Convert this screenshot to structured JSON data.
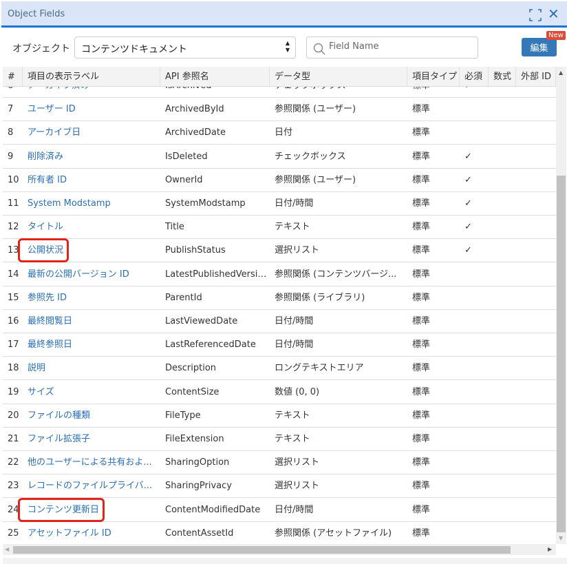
{
  "window": {
    "title": "Object Fields"
  },
  "toolbar": {
    "object_label": "オブジェクト",
    "object_value": "コンテンツドキュメント",
    "search_placeholder": "Field Name",
    "edit_label": "編集",
    "new_badge": "New"
  },
  "columns": [
    "#",
    "項目の表示ラベル",
    "API 参照名",
    "データ型",
    "項目タイプ",
    "必須",
    "数式",
    "外部 ID"
  ],
  "rows": [
    {
      "n": "6",
      "label": "アーカイブ済み",
      "api": "IsArchived",
      "type": "チェックボックス",
      "kind": "標準",
      "req": "✓"
    },
    {
      "n": "7",
      "label": "ユーザー ID",
      "api": "ArchivedById",
      "type": "参照関係 (ユーザー)",
      "kind": "標準",
      "req": ""
    },
    {
      "n": "8",
      "label": "アーカイブ日",
      "api": "ArchivedDate",
      "type": "日付",
      "kind": "標準",
      "req": ""
    },
    {
      "n": "9",
      "label": "削除済み",
      "api": "IsDeleted",
      "type": "チェックボックス",
      "kind": "標準",
      "req": "✓"
    },
    {
      "n": "10",
      "label": "所有者 ID",
      "api": "OwnerId",
      "type": "参照関係 (ユーザー)",
      "kind": "標準",
      "req": "✓"
    },
    {
      "n": "11",
      "label": "System Modstamp",
      "api": "SystemModstamp",
      "type": "日付/時間",
      "kind": "標準",
      "req": "✓"
    },
    {
      "n": "12",
      "label": "タイトル",
      "api": "Title",
      "type": "テキスト",
      "kind": "標準",
      "req": "✓"
    },
    {
      "n": "13",
      "label": "公開状況",
      "api": "PublishStatus",
      "type": "選択リスト",
      "kind": "標準",
      "req": "✓",
      "highlight": true
    },
    {
      "n": "14",
      "label": "最新の公開バージョン ID",
      "api": "LatestPublishedVersionId",
      "type": "参照関係 (コンテンツバージ...",
      "kind": "標準",
      "req": ""
    },
    {
      "n": "15",
      "label": "参照先 ID",
      "api": "ParentId",
      "type": "参照関係 (ライブラリ)",
      "kind": "標準",
      "req": ""
    },
    {
      "n": "16",
      "label": "最終閲覧日",
      "api": "LastViewedDate",
      "type": "日付/時間",
      "kind": "標準",
      "req": ""
    },
    {
      "n": "17",
      "label": "最終参照日",
      "api": "LastReferencedDate",
      "type": "日付/時間",
      "kind": "標準",
      "req": ""
    },
    {
      "n": "18",
      "label": "説明",
      "api": "Description",
      "type": "ロングテキストエリア",
      "kind": "標準",
      "req": ""
    },
    {
      "n": "19",
      "label": "サイズ",
      "api": "ContentSize",
      "type": "数値 (0, 0)",
      "kind": "標準",
      "req": ""
    },
    {
      "n": "20",
      "label": "ファイルの種類",
      "api": "FileType",
      "type": "テキスト",
      "kind": "標準",
      "req": ""
    },
    {
      "n": "21",
      "label": "ファイル拡張子",
      "api": "FileExtension",
      "type": "テキスト",
      "kind": "標準",
      "req": ""
    },
    {
      "n": "22",
      "label": "他のユーザーによる共有およ...",
      "api": "SharingOption",
      "type": "選択リスト",
      "kind": "標準",
      "req": ""
    },
    {
      "n": "23",
      "label": "レコードのファイルプライバ...",
      "api": "SharingPrivacy",
      "type": "選択リスト",
      "kind": "標準",
      "req": ""
    },
    {
      "n": "24",
      "label": "コンテンツ更新日",
      "api": "ContentModifiedDate",
      "type": "日付/時間",
      "kind": "標準",
      "req": "",
      "highlight": true
    },
    {
      "n": "25",
      "label": "アセットファイル ID",
      "api": "ContentAssetId",
      "type": "参照関係 (アセットファイル)",
      "kind": "標準",
      "req": ""
    }
  ],
  "colors": {
    "accent": "#1a73d1",
    "link": "#2a6fb8",
    "highlight": "#e2231a",
    "button": "#3478b8",
    "badge": "#dc4a3a"
  }
}
